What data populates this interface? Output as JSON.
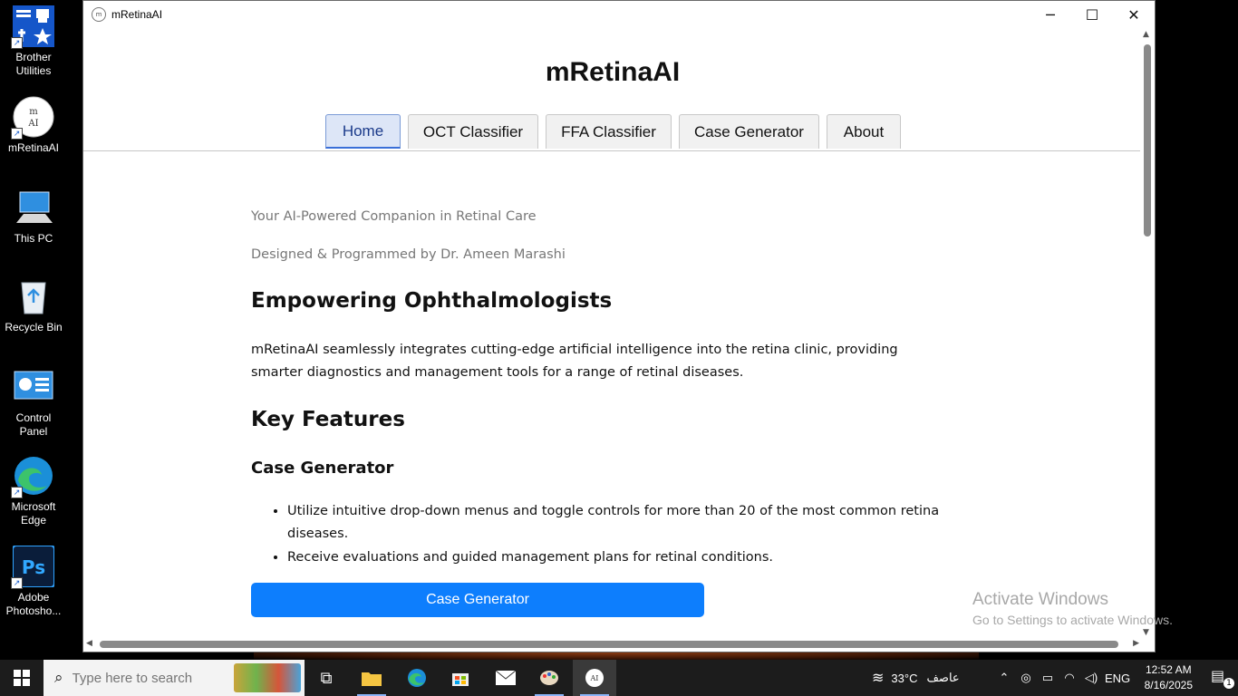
{
  "desktop": {
    "icons": [
      {
        "label": "Brother Utilities",
        "icon": "toolbox-icon"
      },
      {
        "label": "mRetinaAI",
        "icon": "mretinaai-logo-icon"
      },
      {
        "label": "This PC",
        "icon": "computer-icon"
      },
      {
        "label": "Recycle Bin",
        "icon": "recycle-bin-icon"
      },
      {
        "label": "Control Panel",
        "icon": "control-panel-icon"
      },
      {
        "label": "Microsoft Edge",
        "icon": "edge-icon"
      },
      {
        "label": "Adobe Photosho...",
        "icon": "photoshop-icon"
      }
    ]
  },
  "window": {
    "title": "mRetinaAI",
    "controls": {
      "minimize": "─",
      "maximize": "☐",
      "close": "✕"
    }
  },
  "app": {
    "title": "mRetinaAI",
    "tabs": [
      {
        "label": "Home",
        "active": true
      },
      {
        "label": "OCT Classifier",
        "active": false
      },
      {
        "label": "FFA Classifier",
        "active": false
      },
      {
        "label": "Case Generator",
        "active": false
      },
      {
        "label": "About",
        "active": false
      }
    ],
    "tagline": "Your AI-Powered Companion in Retinal Care",
    "credit": "Designed & Programmed by Dr. Ameen Marashi",
    "heading_main": "Empowering Ophthalmologists",
    "intro": "mRetinaAI seamlessly integrates cutting-edge artificial intelligence into the retina clinic, providing smarter diagnostics and management tools for a range of retinal diseases.",
    "heading_features": "Key Features",
    "feature_case": {
      "title": "Case Generator",
      "bullets": [
        "Utilize intuitive drop-down menus and toggle controls for more than 20 of the most common retina diseases.",
        "Receive evaluations and guided management plans for retinal conditions."
      ],
      "button_label": "Case Generator"
    }
  },
  "watermark": {
    "line1": "Activate Windows",
    "line2": "Go to Settings to activate Windows."
  },
  "taskbar": {
    "search_placeholder": "Type here to search",
    "weather_temp": "33°C",
    "weather_text": "عاصف",
    "language": "ENG",
    "time": "12:52 AM",
    "date": "8/16/2025",
    "notification_count": "1"
  },
  "colors": {
    "accent": "#0d7efd",
    "tab_active_bg": "#dde6f7",
    "taskbar": "#1c1c1c"
  }
}
